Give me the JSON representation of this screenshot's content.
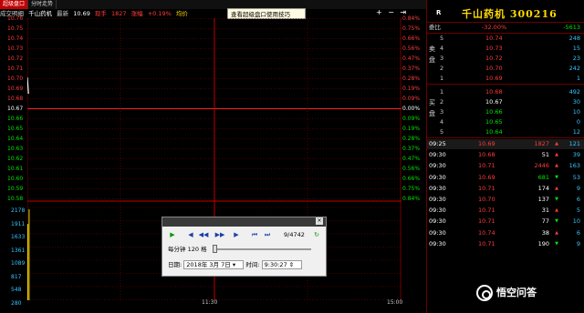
{
  "tabs": [
    {
      "label": "超级盘口",
      "active": true
    },
    {
      "label": "分时走势",
      "active": false
    }
  ],
  "infobar": {
    "prefix": "成交明细",
    "stock_name": "千山药机",
    "latest_label": "最新",
    "latest_value": "10.69",
    "volume_label": "现手",
    "volume_value": "1827",
    "change_label": "涨幅",
    "change_value": "+0.19%",
    "avg_label": "均价"
  },
  "tip": "查看超级盘口使用技巧",
  "window_controls": "+ − ⇥",
  "price_axis": {
    "left": [
      "10.76",
      "10.75",
      "10.74",
      "10.73",
      "10.72",
      "10.71",
      "10.70",
      "10.69",
      "10.68",
      "10.67",
      "10.66",
      "10.65",
      "10.64",
      "10.63",
      "10.62",
      "10.61",
      "10.60",
      "10.59",
      "10.58"
    ],
    "right": [
      "0.84%",
      "0.75%",
      "0.66%",
      "0.56%",
      "0.47%",
      "0.37%",
      "0.28%",
      "0.19%",
      "0.09%",
      "0.00%",
      "0.09%",
      "0.19%",
      "0.28%",
      "0.37%",
      "0.47%",
      "0.56%",
      "0.66%",
      "0.75%",
      "0.84%"
    ],
    "prev_close_index": 9
  },
  "volume_axis": [
    "2178",
    "1911",
    "1633",
    "1361",
    "1089",
    "817",
    "548",
    "280"
  ],
  "time_labels": [
    "11:30",
    "15:00"
  ],
  "chart_data": {
    "type": "line",
    "x": [
      "09:25",
      "09:30"
    ],
    "series": [
      {
        "values": [
          10.69,
          10.69
        ]
      }
    ],
    "volume": [
      1827,
      2178
    ],
    "ylim": [
      10.58,
      10.76
    ],
    "prev_close": 10.67
  },
  "quote": {
    "r_label": "R",
    "stock_name": "千山药机",
    "code": "300216",
    "weibi_label": "委比",
    "weibi_value": "-32.00%",
    "weicha_value": "-5613",
    "sell_label": "卖盘",
    "buy_label": "买盘",
    "asks": [
      {
        "level": "5",
        "price": "10.74",
        "volume": "248"
      },
      {
        "level": "4",
        "price": "10.73",
        "volume": "15"
      },
      {
        "level": "3",
        "price": "10.72",
        "volume": "23"
      },
      {
        "level": "2",
        "price": "10.70",
        "volume": "242"
      },
      {
        "level": "1",
        "price": "10.69",
        "volume": "1"
      }
    ],
    "bids": [
      {
        "level": "1",
        "price": "10.68",
        "volume": "492"
      },
      {
        "level": "2",
        "price": "10.67",
        "volume": "30"
      },
      {
        "level": "3",
        "price": "10.66",
        "volume": "10"
      },
      {
        "level": "4",
        "price": "10.65",
        "volume": "0"
      },
      {
        "level": "5",
        "price": "10.64",
        "volume": "12"
      }
    ],
    "ticks": [
      {
        "time": "09:25",
        "price": "10.69",
        "volume": "1827",
        "dir": "up",
        "count": "121"
      },
      {
        "time": "09:30",
        "price": "10.68",
        "volume": "51",
        "dir": "up",
        "count": "39"
      },
      {
        "time": "09:30",
        "price": "10.71",
        "volume": "2446",
        "dir": "up",
        "count": "163"
      },
      {
        "time": "09:30",
        "price": "10.69",
        "volume": "681",
        "dir": "down",
        "count": "53"
      },
      {
        "time": "09:30",
        "price": "10.71",
        "volume": "174",
        "dir": "up",
        "count": "9"
      },
      {
        "time": "09:30",
        "price": "10.70",
        "volume": "137",
        "dir": "down",
        "count": "6"
      },
      {
        "time": "09:30",
        "price": "10.71",
        "volume": "31",
        "dir": "up",
        "count": "5"
      },
      {
        "time": "09:30",
        "price": "10.71",
        "volume": "77",
        "dir": "down",
        "count": "10"
      },
      {
        "time": "09:30",
        "price": "10.74",
        "volume": "38",
        "dir": "up",
        "count": "6"
      },
      {
        "time": "09:30",
        "price": "10.71",
        "volume": "190",
        "dir": "down",
        "count": "9"
      }
    ]
  },
  "replay_dialog": {
    "close": "×",
    "progress": "9/4742",
    "speed_label": "每分钟",
    "speed_value": "120",
    "speed_unit": "格",
    "date_label": "日期:",
    "date_value": "2018年 3月 7日",
    "time_label": "时间:",
    "time_value": "9:30:27"
  },
  "watermark": "悟空问答",
  "colors": {
    "up": "#ff3c3c",
    "down": "#00e600",
    "grid": "#8a0000",
    "price_line": "#ffffff"
  }
}
